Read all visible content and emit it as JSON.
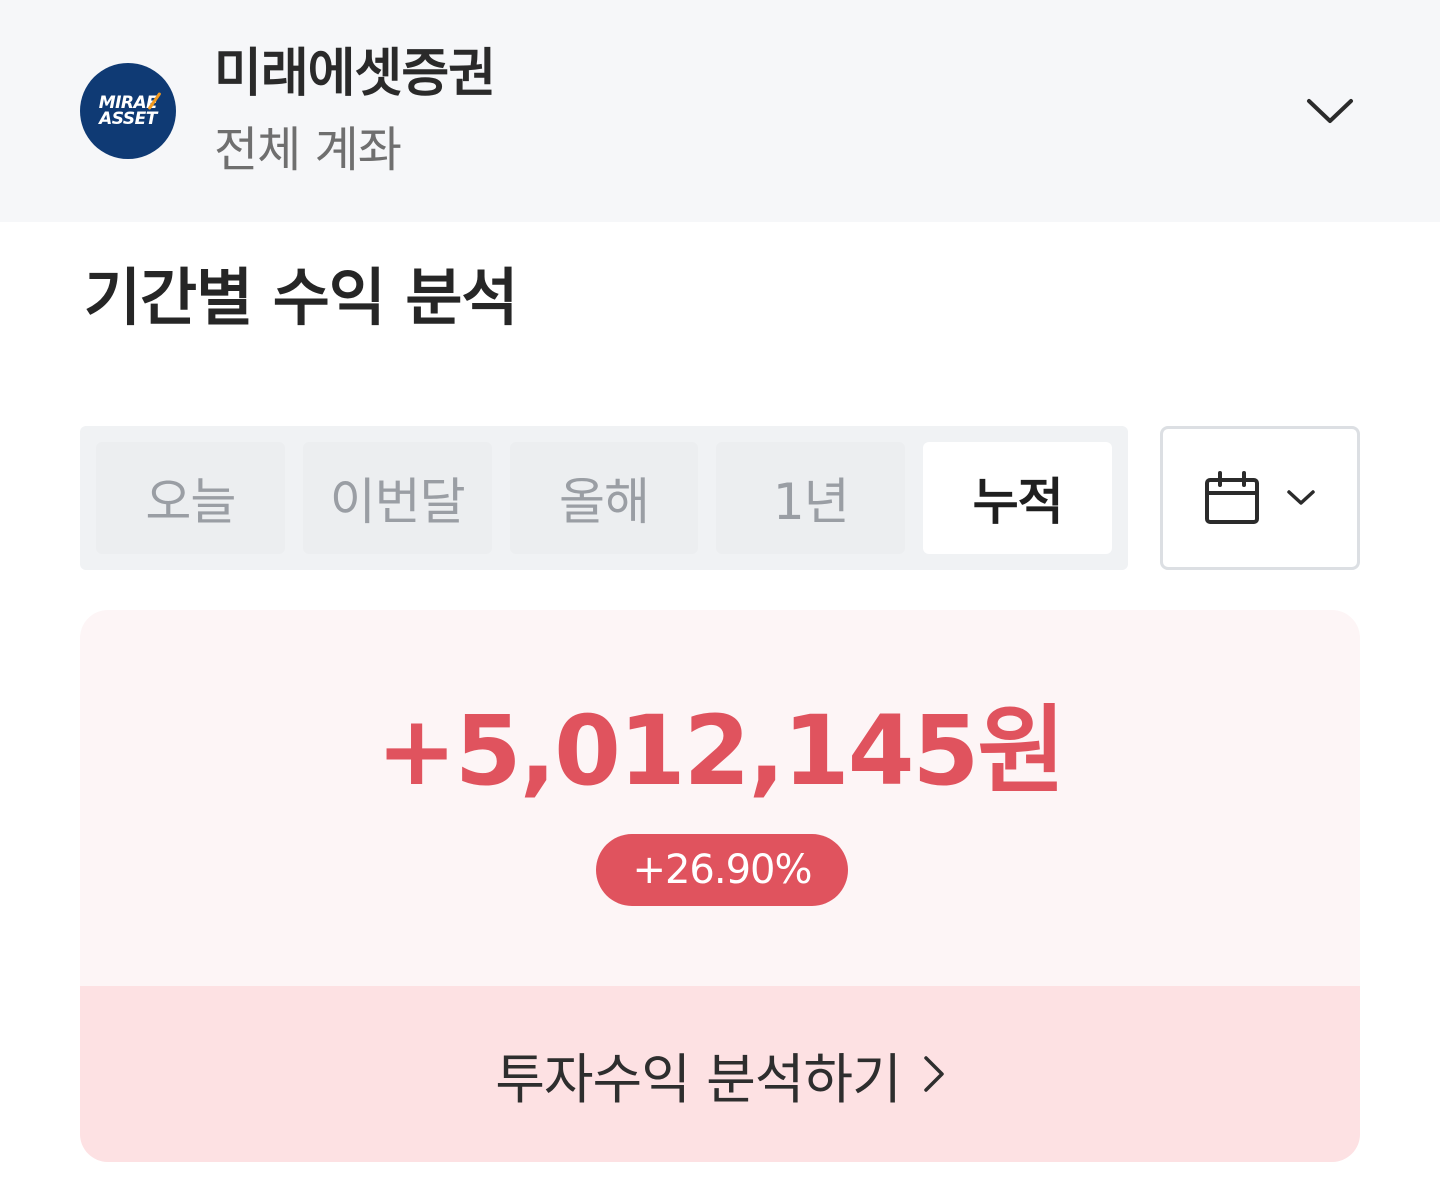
{
  "account": {
    "logo_line1": "MIRAE",
    "logo_line2": "ASSET",
    "broker_name": "미래에셋증권",
    "scope": "전체 계좌"
  },
  "section": {
    "title": "기간별 수익 분석"
  },
  "period_tabs": [
    {
      "label": "오늘",
      "active": false
    },
    {
      "label": "이번달",
      "active": false
    },
    {
      "label": "올해",
      "active": false
    },
    {
      "label": "1년",
      "active": false
    },
    {
      "label": "누적",
      "active": true
    }
  ],
  "date_picker": {
    "icon": "calendar-icon"
  },
  "profit": {
    "amount": "+5,012,145원",
    "rate": "+26.90%",
    "analyze_label": "투자수익 분석하기",
    "positive_color": "#e0535e"
  },
  "colors": {
    "logo_blue": "#0f3a74",
    "header_bg": "#f6f7f9",
    "card_bg": "#fdf5f6",
    "link_bg": "#fde1e3"
  }
}
